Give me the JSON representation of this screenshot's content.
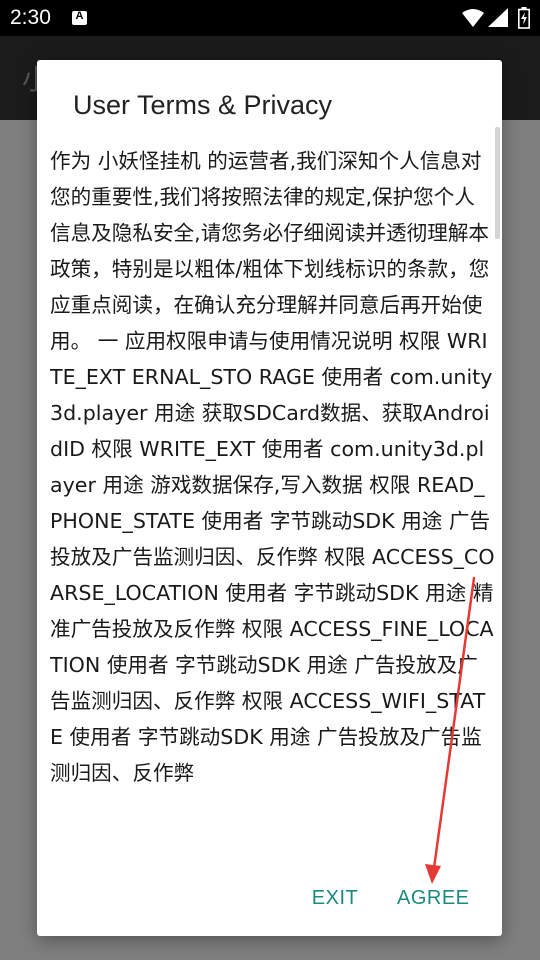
{
  "status_bar": {
    "time": "2:30",
    "notification_icon_letter": "A",
    "icons": [
      "notification-a-icon",
      "wifi-icon",
      "signal-icon",
      "battery-icon"
    ]
  },
  "app_bar": {
    "title": "小"
  },
  "dialog": {
    "title": "User Terms & Privacy",
    "body": "作为 小妖怪挂机 的运营者,我们深知个人信息对您的重要性,我们将按照法律的规定,保护您个人信息及隐私安全,请您务必仔细阅读并透彻理解本政策，特别是以粗体/粗体下划线标识的条款，您应重点阅读，在确认充分理解并同意后再开始使用。 一 应用权限申请与使用情况说明 权限 WRITE_EXT ERNAL_STO RAGE 使用者 com.unity3d.player 用途 获取SDCard数据、获取AndroidID 权限 WRITE_EXT 使用者 com.unity3d.player 用途 游戏数据保存,写入数据 权限 READ_PHONE_STATE 使用者 字节跳动SDK 用途 广告投放及广告监测归因、反作弊 权限 ACCESS_COARSE_LOCATION 使用者 字节跳动SDK 用途 精准广告投放及反作弊 权限 ACCESS_FINE_LOCATION 使用者 字节跳动SDK 用途 广告投放及广告监测归因、反作弊 权限 ACCESS_WIFI_STATE 使用者 字节跳动SDK 用途 广告投放及广告监测归因、反作弊",
    "buttons": {
      "exit_label": "EXIT",
      "agree_label": "AGREE"
    }
  },
  "colors": {
    "accent": "#1a8a7e",
    "annotation_arrow": "#e53935",
    "scrim": "#7f7f7f",
    "status_bar": "#000000"
  }
}
